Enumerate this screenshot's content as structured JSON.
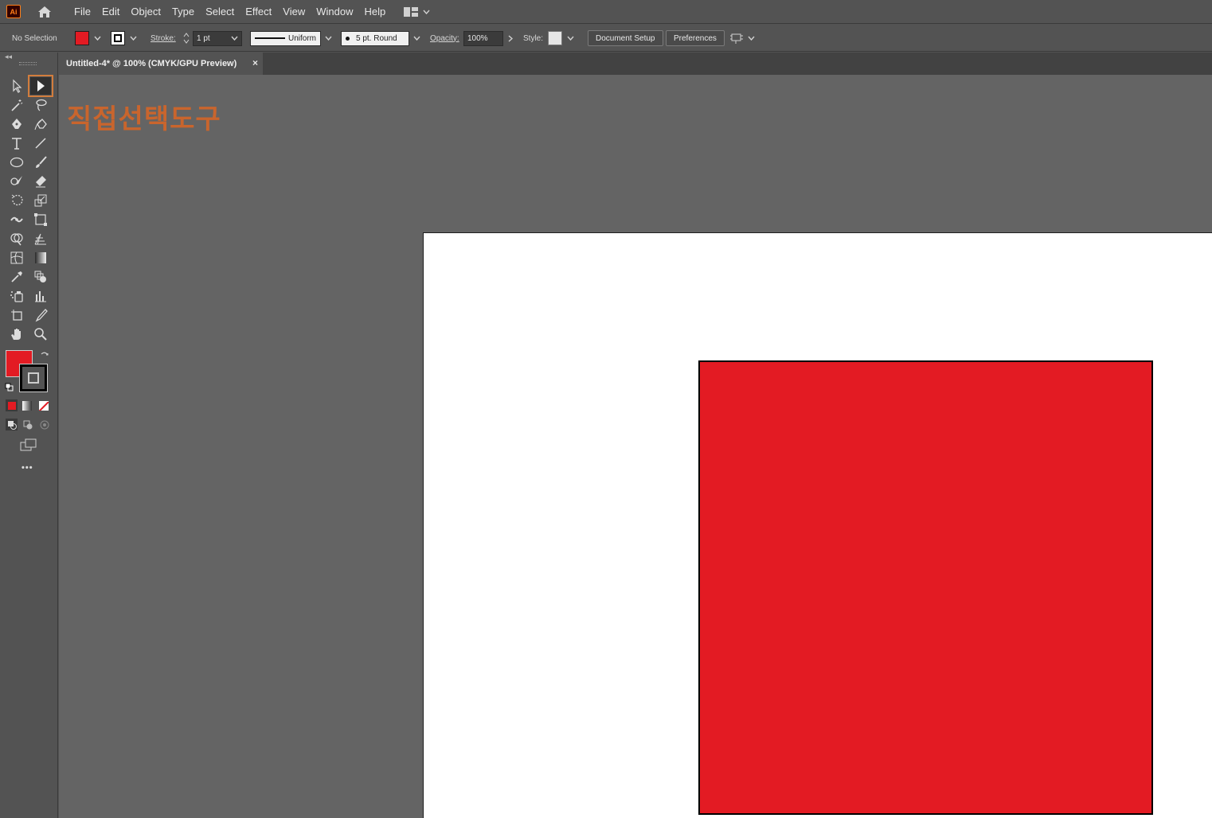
{
  "app": {
    "logo_text": "Ai"
  },
  "menus": [
    "File",
    "Edit",
    "Object",
    "Type",
    "Select",
    "Effect",
    "View",
    "Window",
    "Help"
  ],
  "control_bar": {
    "selection_label": "No Selection",
    "fill_color": "#e31b23",
    "stroke_label": "Stroke:",
    "stroke_weight": "1 pt",
    "stroke_profile": "Uniform",
    "brush": "5 pt. Round",
    "opacity_label": "Opacity:",
    "opacity_value": "100%",
    "style_label": "Style:",
    "document_setup": "Document Setup",
    "preferences": "Preferences"
  },
  "document": {
    "tab_title": "Untitled-4* @ 100% (CMYK/GPU Preview)",
    "close_glyph": "×"
  },
  "canvas": {
    "annotation_text": "직접선택도구",
    "annotation_color": "#c9652d",
    "shape_fill": "#e31b23"
  },
  "tools": {
    "active": "direct-selection-tool",
    "more_label": "•••"
  },
  "colors": {
    "ui_bg": "#535353",
    "canvas_bg": "#646464",
    "accent": "#d27d3d"
  }
}
